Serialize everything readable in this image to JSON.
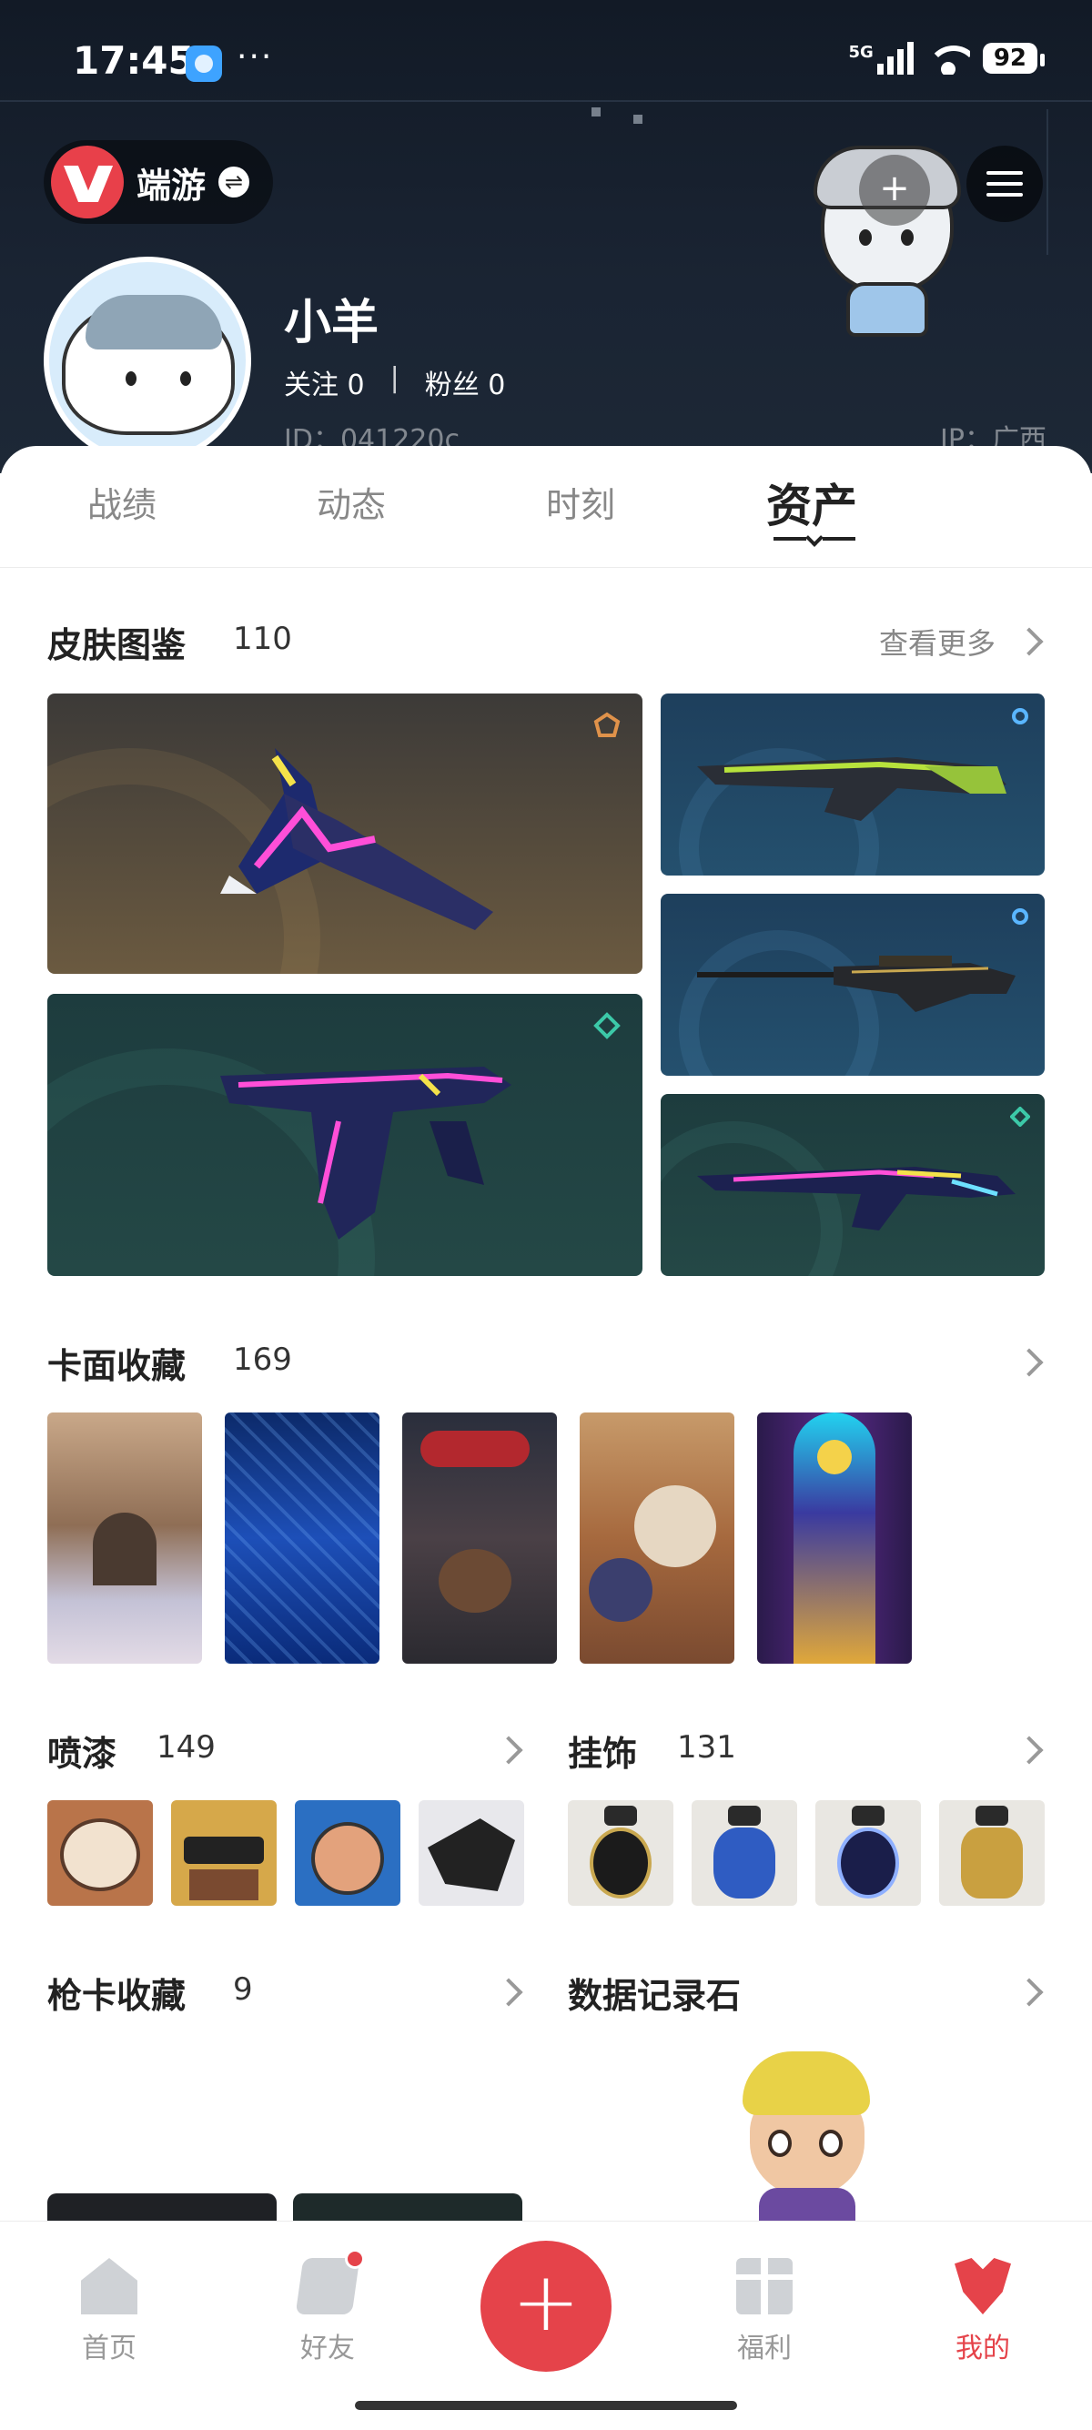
{
  "status_bar": {
    "time": "17:45",
    "more": "···",
    "signal_label": "5G",
    "battery": "92"
  },
  "header": {
    "game_name": "端游",
    "user_name": "小羊",
    "following_label": "关注 0",
    "separator": "|",
    "fans_label": "粉丝 0",
    "id_text": "ID：041220c",
    "ip_text": "IP：广西"
  },
  "tabs": [
    "战绩",
    "动态",
    "时刻",
    "资产"
  ],
  "active_tab": "资产",
  "skins": {
    "title": "皮肤图鉴",
    "count": "110",
    "more": "查看更多"
  },
  "cards": {
    "title": "卡面收藏",
    "count": "169"
  },
  "sprays": {
    "title": "喷漆",
    "count": "149"
  },
  "charms": {
    "title": "挂饰",
    "count": "131"
  },
  "gun_cards": {
    "title": "枪卡收藏",
    "count": "9"
  },
  "data_stone": {
    "title": "数据记录石"
  },
  "bottom_nav": [
    {
      "label": "首页",
      "icon": "home-icon"
    },
    {
      "label": "好友",
      "icon": "friends-icon"
    },
    {
      "label": "福利",
      "icon": "gift-icon"
    },
    {
      "label": "我的",
      "icon": "profile-icon"
    }
  ],
  "fab_symbol": "+",
  "colors": {
    "accent": "#e5434a",
    "header_bg": "#1a2433"
  }
}
